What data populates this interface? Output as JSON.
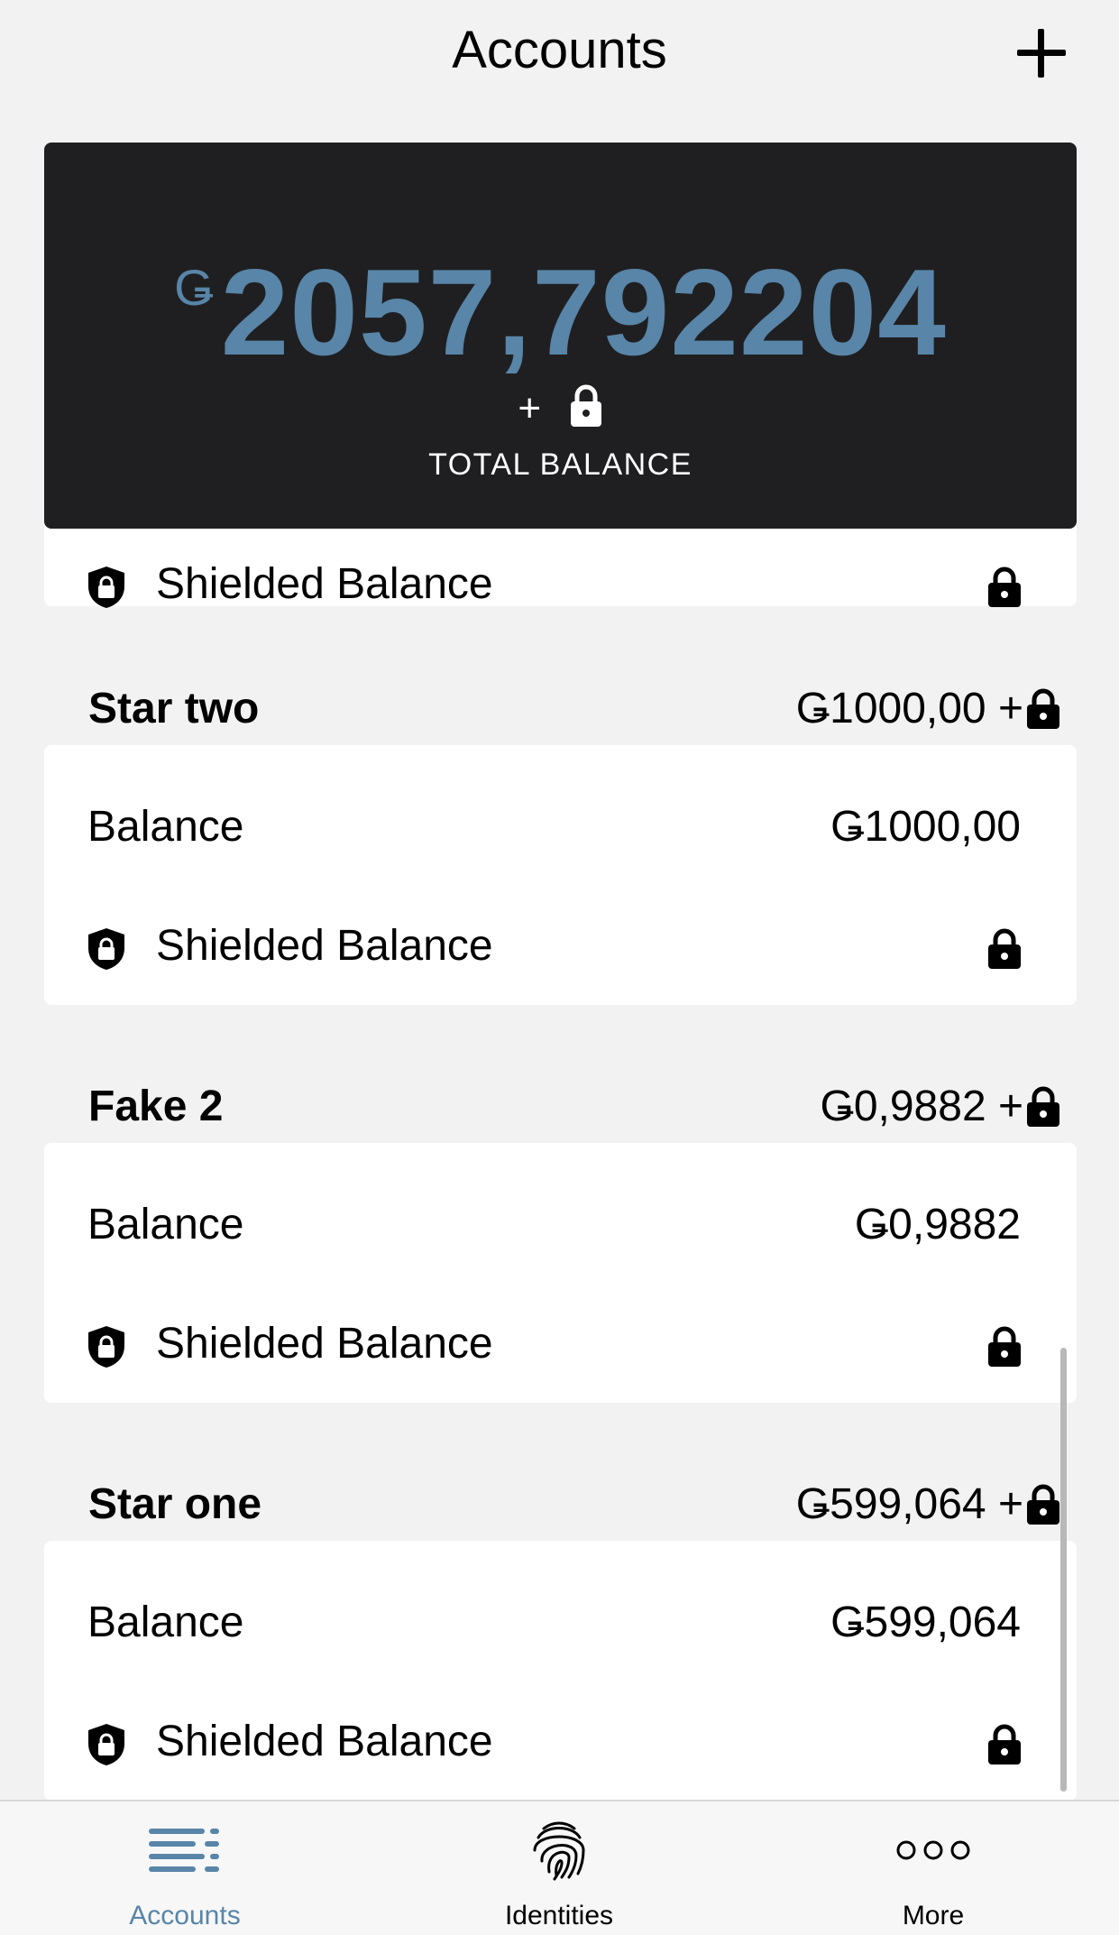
{
  "header": {
    "title": "Accounts"
  },
  "total": {
    "currency": "Ǥ",
    "amount": "2057,792204",
    "plus": "+",
    "label": "TOTAL BALANCE"
  },
  "partial_account": {
    "shielded_label": "Shielded Balance"
  },
  "accounts": [
    {
      "name": "Star two",
      "summary": "Ǥ1000,00 +",
      "balance_label": "Balance",
      "balance_value": "Ǥ1000,00",
      "shielded_label": "Shielded Balance"
    },
    {
      "name": "Fake 2",
      "summary": "Ǥ0,9882 +",
      "balance_label": "Balance",
      "balance_value": "Ǥ0,9882",
      "shielded_label": "Shielded Balance"
    },
    {
      "name": "Star one",
      "summary": "Ǥ599,064 +",
      "balance_label": "Balance",
      "balance_value": "Ǥ599,064",
      "shielded_label": "Shielded Balance"
    }
  ],
  "tabs": [
    {
      "label": "Accounts",
      "icon": "accounts-list-icon",
      "active": true
    },
    {
      "label": "Identities",
      "icon": "fingerprint-icon",
      "active": false
    },
    {
      "label": "More",
      "icon": "more-dots-icon",
      "active": false
    }
  ],
  "colors": {
    "accent": "#5885a8",
    "card_dark": "#1f1f21",
    "background": "#f2f2f2",
    "card": "#ffffff"
  }
}
